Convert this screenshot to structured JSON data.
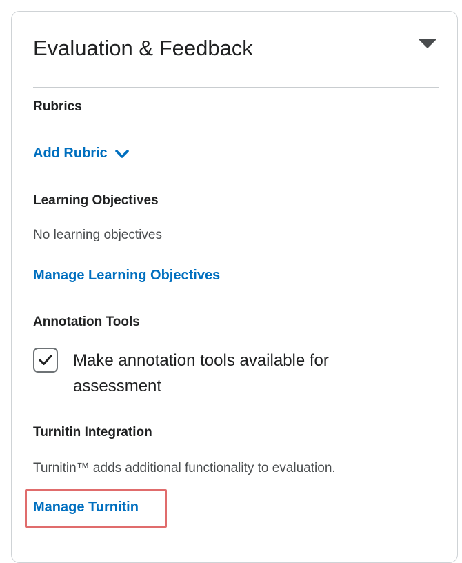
{
  "panel": {
    "title": "Evaluation & Feedback",
    "toggle_icon": "caret-down-icon"
  },
  "rubrics": {
    "heading": "Rubrics",
    "add_link": "Add Rubric",
    "add_icon": "chevron-down-icon"
  },
  "learning_objectives": {
    "heading": "Learning Objectives",
    "empty_text": "No learning objectives",
    "manage_link": "Manage Learning Objectives"
  },
  "annotation_tools": {
    "heading": "Annotation Tools",
    "checkbox_label": "Make annotation tools available for assessment",
    "checked": true
  },
  "turnitin": {
    "heading": "Turnitin Integration",
    "description": "Turnitin™ adds additional functionality to evaluation.",
    "manage_link": "Manage Turnitin"
  },
  "colors": {
    "link": "#006fbf",
    "highlight": "#e06c6c",
    "heading_text": "#202122",
    "body_text": "#494c4e"
  }
}
